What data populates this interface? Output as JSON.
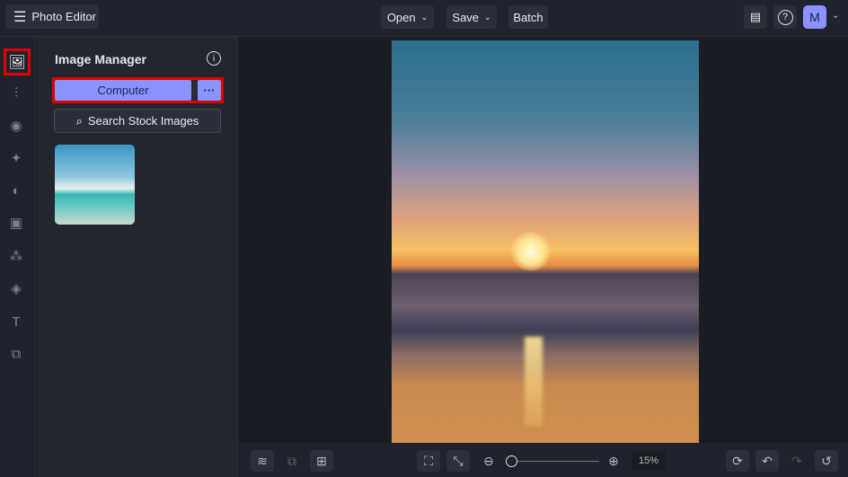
{
  "app": {
    "title": "Photo Editor",
    "menu": [
      "Open",
      "Save",
      "Batch"
    ],
    "avatar": "M"
  },
  "panel": {
    "title": "Image Manager",
    "computer": "Computer",
    "more": "···",
    "search": "Search Stock Images"
  },
  "zoom": {
    "value": "15%",
    "slider_fraction": 0.0
  },
  "colors": {
    "accent": "#8b93ff",
    "highlight": "#e00000"
  }
}
